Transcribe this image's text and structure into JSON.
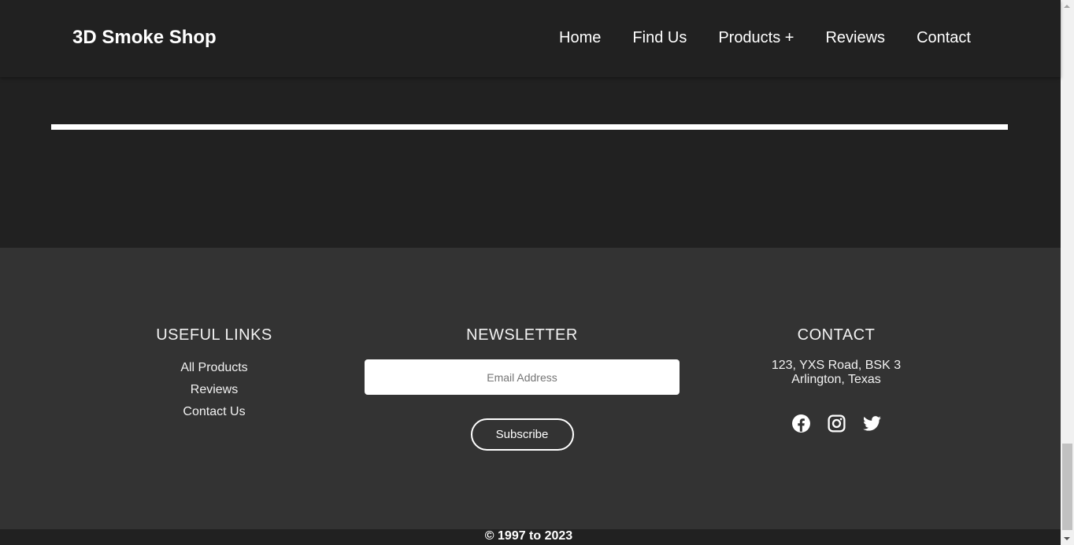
{
  "header": {
    "brand": "3D Smoke Shop",
    "nav": [
      "Home",
      "Find Us",
      "Products +",
      "Reviews",
      "Contact"
    ]
  },
  "footer": {
    "useful_links": {
      "title": "USEFUL LINKS",
      "items": [
        "All Products",
        "Reviews",
        "Contact Us"
      ]
    },
    "newsletter": {
      "title": "NEWSLETTER",
      "email_placeholder": "Email Address",
      "subscribe_label": "Subscribe"
    },
    "contact": {
      "title": "CONTACT",
      "address_line1": "123, YXS Road, BSK 3",
      "address_line2": "Arlington, Texas",
      "socials": [
        "facebook-icon",
        "instagram-icon",
        "twitter-icon"
      ]
    },
    "copyright": "© 1997 to 2023"
  },
  "colors": {
    "header_bg": "#212121",
    "footer_bg": "#333333",
    "text": "#ffffff"
  }
}
